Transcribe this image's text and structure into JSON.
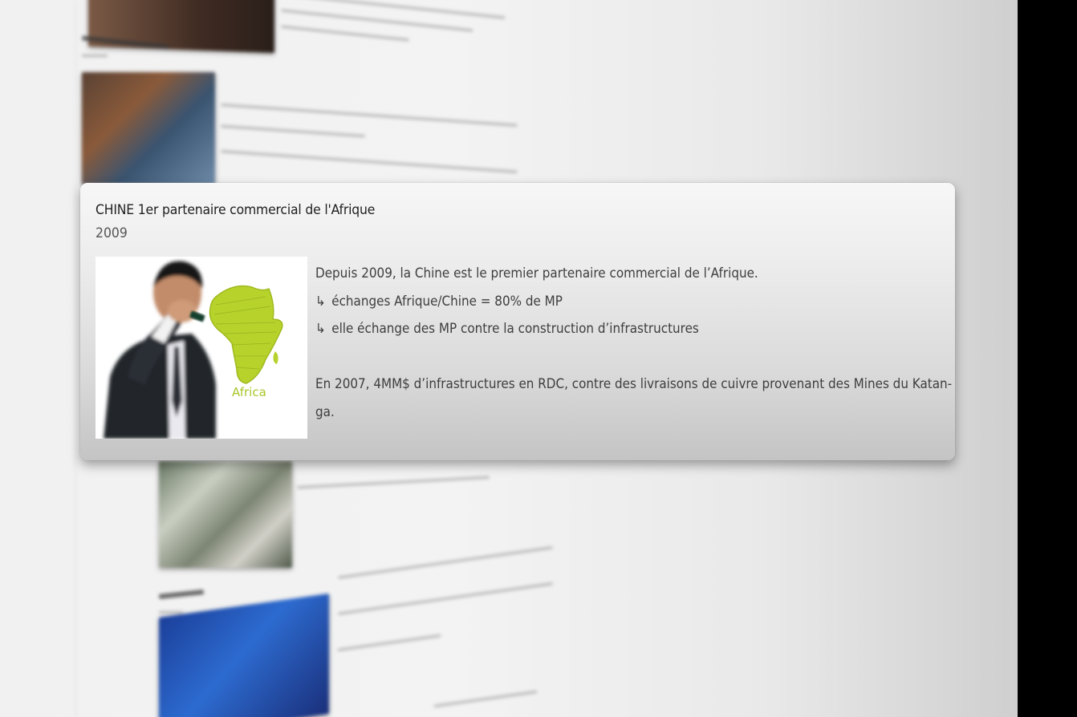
{
  "card": {
    "title": "CHINE 1er partenaire commercial de l'Afrique",
    "year": "2009",
    "image_label": "Africa",
    "lines": {
      "l1": "Depuis 2009, la Chine est le premier partenaire commercial de l’Afrique.",
      "l2": "échanges Afrique/Chine = 80% de MP",
      "l3": "elle échange des MP contre la construction d’infrastructures",
      "l4": "En 2007, 4MM$ d’infrastructures en RDC, contre des livraisons de cuivre provenant des Mines du Katan-",
      "l5": "ga."
    },
    "arrow_glyph": "↳"
  },
  "colors": {
    "card_bg_top": "#f7f7f7",
    "card_bg_bottom": "#c4c4c4",
    "africa_green": "#b6d22b",
    "page_bg": "#f1f1f1",
    "right_edge": "#000000"
  }
}
